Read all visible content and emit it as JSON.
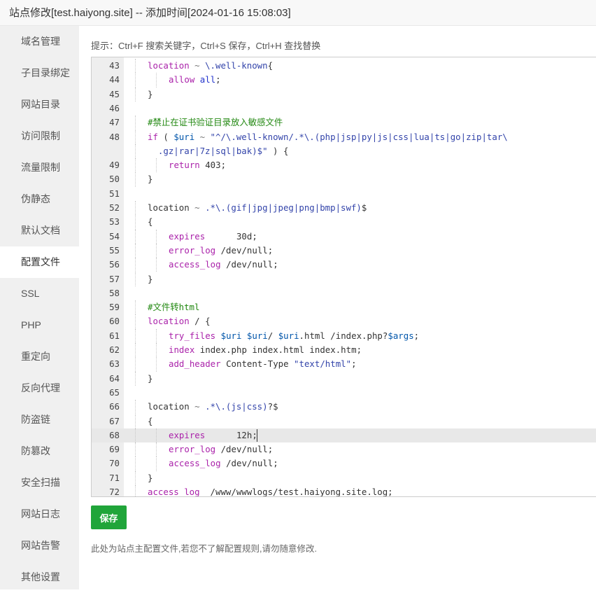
{
  "window": {
    "title": "站点修改[test.haiyong.site] -- 添加时间[2024-01-16 15:08:03]"
  },
  "sidebar": {
    "active_index": 7,
    "items": [
      {
        "label": "域名管理",
        "key": "domain"
      },
      {
        "label": "子目录绑定",
        "key": "subdir"
      },
      {
        "label": "网站目录",
        "key": "sitedir"
      },
      {
        "label": "访问限制",
        "key": "access-limit"
      },
      {
        "label": "流量限制",
        "key": "traffic-limit"
      },
      {
        "label": "伪静态",
        "key": "rewrite"
      },
      {
        "label": "默认文档",
        "key": "default-doc"
      },
      {
        "label": "配置文件",
        "key": "config-file"
      },
      {
        "label": "SSL",
        "key": "ssl"
      },
      {
        "label": "PHP",
        "key": "php"
      },
      {
        "label": "重定向",
        "key": "redirect"
      },
      {
        "label": "反向代理",
        "key": "reverse-proxy"
      },
      {
        "label": "防盗链",
        "key": "hotlink"
      },
      {
        "label": "防篡改",
        "key": "tamper"
      },
      {
        "label": "安全扫描",
        "key": "security-scan"
      },
      {
        "label": "网站日志",
        "key": "site-log"
      },
      {
        "label": "网站告警",
        "key": "site-alert"
      },
      {
        "label": "其他设置",
        "key": "other-settings"
      }
    ]
  },
  "hint": "提示：Ctrl+F 搜索关键字，Ctrl+S 保存，Ctrl+H 查找替换",
  "editor": {
    "highlight_line": 68,
    "lines": [
      {
        "n": "43",
        "indent": 1,
        "tokens": [
          [
            "kw",
            "location"
          ],
          [
            "op",
            " ~ "
          ],
          [
            "str",
            "\\.well-known"
          ],
          [
            "plain",
            "{"
          ]
        ]
      },
      {
        "n": "44",
        "indent": 2,
        "tokens": [
          [
            "kw",
            "allow"
          ],
          [
            "plain",
            " "
          ],
          [
            "atom",
            "all"
          ],
          [
            "plain",
            ";"
          ]
        ]
      },
      {
        "n": "45",
        "indent": 1,
        "tokens": [
          [
            "plain",
            "}"
          ]
        ]
      },
      {
        "n": "46",
        "indent": 0,
        "tokens": []
      },
      {
        "n": "47",
        "indent": 1,
        "tokens": [
          [
            "comment",
            "#禁止在证书验证目录放入敏感文件"
          ]
        ]
      },
      {
        "n": "48",
        "indent": 1,
        "tokens": [
          [
            "kw",
            "if"
          ],
          [
            "plain",
            " ( "
          ],
          [
            "var",
            "$uri"
          ],
          [
            "op",
            " ~ "
          ],
          [
            "str",
            "\"^/\\.well-known/.*\\.(php|jsp|py|js|css|lua|ts|go|zip|tar\\"
          ]
        ]
      },
      {
        "n": "",
        "indent": 1,
        "tokens": [
          [
            "str",
            "  .gz|rar|7z|sql|bak)$\""
          ],
          [
            "plain",
            " ) {"
          ]
        ]
      },
      {
        "n": "49",
        "indent": 2,
        "tokens": [
          [
            "kw",
            "return"
          ],
          [
            "plain",
            " 403;"
          ]
        ]
      },
      {
        "n": "50",
        "indent": 1,
        "tokens": [
          [
            "plain",
            "}"
          ]
        ]
      },
      {
        "n": "51",
        "indent": 0,
        "tokens": []
      },
      {
        "n": "52",
        "indent": 1,
        "tokens": [
          [
            "plain",
            "location"
          ],
          [
            "op",
            " ~ "
          ],
          [
            "str",
            ".*\\.(gif|jpg|jpeg|png|bmp|swf)"
          ],
          [
            "plain",
            "$"
          ]
        ]
      },
      {
        "n": "53",
        "indent": 1,
        "tokens": [
          [
            "plain",
            "{"
          ]
        ]
      },
      {
        "n": "54",
        "indent": 2,
        "tokens": [
          [
            "kw",
            "expires"
          ],
          [
            "plain",
            "      30d;"
          ]
        ]
      },
      {
        "n": "55",
        "indent": 2,
        "tokens": [
          [
            "kw",
            "error_log"
          ],
          [
            "plain",
            " /dev/null;"
          ]
        ]
      },
      {
        "n": "56",
        "indent": 2,
        "tokens": [
          [
            "kw",
            "access_log"
          ],
          [
            "plain",
            " /dev/null;"
          ]
        ]
      },
      {
        "n": "57",
        "indent": 1,
        "tokens": [
          [
            "plain",
            "}"
          ]
        ]
      },
      {
        "n": "58",
        "indent": 0,
        "tokens": []
      },
      {
        "n": "59",
        "indent": 1,
        "tokens": [
          [
            "comment",
            "#文件转html"
          ]
        ]
      },
      {
        "n": "60",
        "indent": 1,
        "tokens": [
          [
            "kw",
            "location"
          ],
          [
            "plain",
            " / {"
          ]
        ]
      },
      {
        "n": "61",
        "indent": 2,
        "tokens": [
          [
            "kw",
            "try_files"
          ],
          [
            "plain",
            " "
          ],
          [
            "var",
            "$uri"
          ],
          [
            "plain",
            " "
          ],
          [
            "var",
            "$uri"
          ],
          [
            "plain",
            "/ "
          ],
          [
            "var",
            "$uri"
          ],
          [
            "plain",
            ".html /index.php?"
          ],
          [
            "var",
            "$args"
          ],
          [
            "plain",
            ";"
          ]
        ]
      },
      {
        "n": "62",
        "indent": 2,
        "tokens": [
          [
            "kw",
            "index"
          ],
          [
            "plain",
            " index.php index.html index.htm;"
          ]
        ]
      },
      {
        "n": "63",
        "indent": 2,
        "tokens": [
          [
            "kw",
            "add_header"
          ],
          [
            "plain",
            " Content-Type "
          ],
          [
            "str",
            "\"text/html\""
          ],
          [
            "plain",
            ";"
          ]
        ]
      },
      {
        "n": "64",
        "indent": 1,
        "tokens": [
          [
            "plain",
            "}"
          ]
        ]
      },
      {
        "n": "65",
        "indent": 0,
        "tokens": []
      },
      {
        "n": "66",
        "indent": 1,
        "tokens": [
          [
            "plain",
            "location"
          ],
          [
            "op",
            " ~ "
          ],
          [
            "str",
            ".*\\.(js|css)"
          ],
          [
            "plain",
            "?$"
          ]
        ]
      },
      {
        "n": "67",
        "indent": 1,
        "tokens": [
          [
            "plain",
            "{"
          ]
        ]
      },
      {
        "n": "68",
        "indent": 2,
        "tokens": [
          [
            "kw",
            "expires"
          ],
          [
            "plain",
            "      12h;"
          ]
        ]
      },
      {
        "n": "69",
        "indent": 2,
        "tokens": [
          [
            "kw",
            "error_log"
          ],
          [
            "plain",
            " /dev/null;"
          ]
        ]
      },
      {
        "n": "70",
        "indent": 2,
        "tokens": [
          [
            "kw",
            "access_log"
          ],
          [
            "plain",
            " /dev/null;"
          ]
        ]
      },
      {
        "n": "71",
        "indent": 1,
        "tokens": [
          [
            "plain",
            "}"
          ]
        ]
      },
      {
        "n": "72",
        "indent": 1,
        "tokens": [
          [
            "kw",
            "access_log"
          ],
          [
            "plain",
            "  /www/wwwlogs/test.haiyong.site.log;"
          ]
        ]
      }
    ]
  },
  "buttons": {
    "save": "保存"
  },
  "note": "此处为站点主配置文件,若您不了解配置规则,请勿随意修改.",
  "colors": {
    "keyword": "#aa22aa",
    "string": "#3344aa",
    "comment": "#228811",
    "variable": "#0055aa",
    "atom": "#2233cc",
    "operator": "#777777",
    "primary_button": "#20a53a"
  }
}
